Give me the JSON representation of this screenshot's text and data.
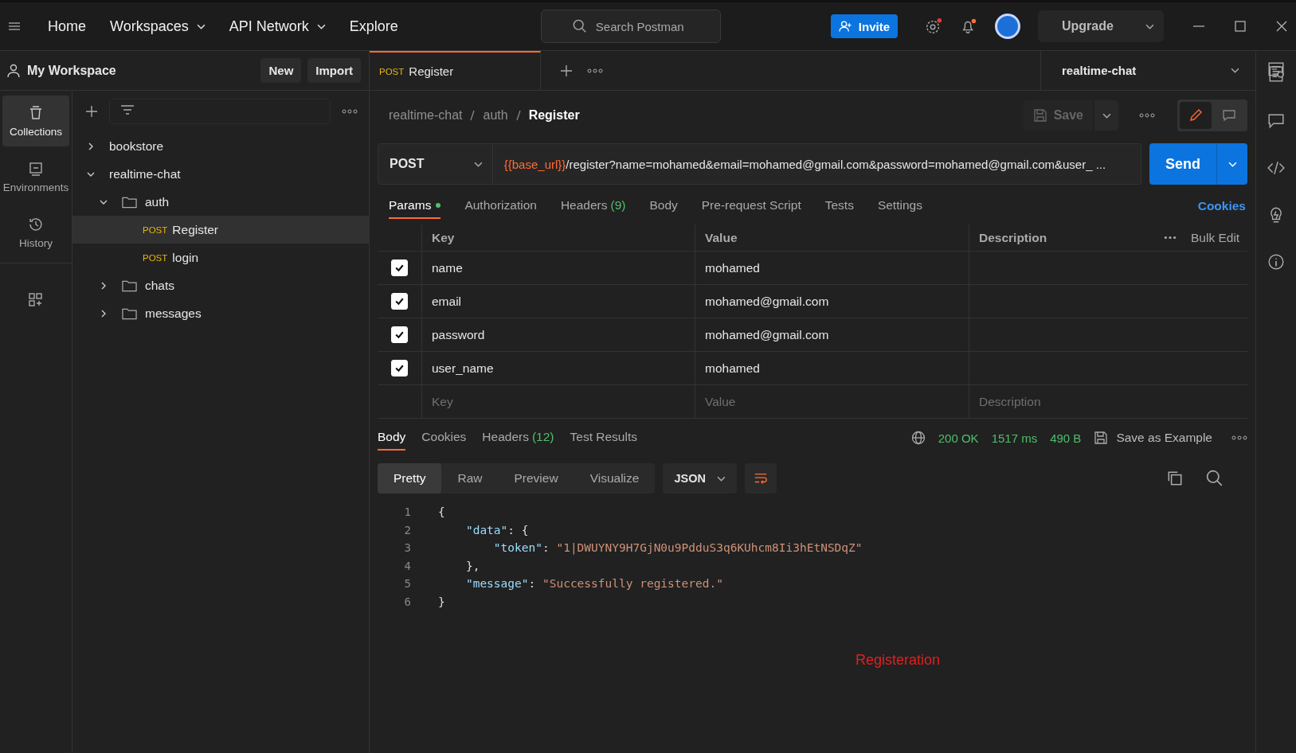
{
  "topbar": {
    "nav": [
      {
        "label": "Home",
        "dropdown": false
      },
      {
        "label": "Workspaces",
        "dropdown": true
      },
      {
        "label": "API Network",
        "dropdown": true
      },
      {
        "label": "Explore",
        "dropdown": false
      }
    ],
    "search": {
      "placeholder": "Search Postman"
    },
    "invite": "Invite",
    "upgrade": "Upgrade"
  },
  "workspace": {
    "name": "My Workspace",
    "buttons": [
      "New",
      "Import"
    ]
  },
  "rail": [
    {
      "label": "Collections",
      "selected": true
    },
    {
      "label": "Environments",
      "selected": false
    },
    {
      "label": "History",
      "selected": false
    },
    {
      "selected": false
    }
  ],
  "tree": [
    {
      "name": "bookstore",
      "kind": "collection",
      "expanded": false,
      "selected": false
    },
    {
      "name": "realtime-chat",
      "kind": "collection",
      "expanded": true,
      "selected": false,
      "children": [
        {
          "name": "auth",
          "kind": "folder",
          "expanded": true,
          "selected": false,
          "children": [
            {
              "name": "Register",
              "kind": "request",
              "method": "POST",
              "selected": true
            },
            {
              "name": "login",
              "kind": "request",
              "method": "POST",
              "selected": false
            }
          ]
        },
        {
          "name": "chats",
          "kind": "folder",
          "expanded": false,
          "selected": false
        },
        {
          "name": "messages",
          "kind": "folder",
          "expanded": false,
          "selected": false
        }
      ]
    }
  ],
  "tabs": [
    {
      "method": "POST",
      "label": "Register",
      "selected": true
    }
  ],
  "environment": "realtime-chat",
  "breadcrumb": [
    "realtime-chat",
    "auth",
    "Register"
  ],
  "save": "Save",
  "request": {
    "method": "POST",
    "url_variable": "{{base_url}}",
    "url_rest": "/register?name=mohamed&email=mohamed@gmail.com&password=mohamed@gmail.com&user_ ...",
    "send": "Send"
  },
  "request_tabs": [
    {
      "label": "Params",
      "dot": true,
      "selected": true
    },
    {
      "label": "Authorization",
      "selected": false
    },
    {
      "label": "Headers",
      "count": "(9)",
      "selected": false
    },
    {
      "label": "Body",
      "selected": false
    },
    {
      "label": "Pre-request Script",
      "selected": false
    },
    {
      "label": "Tests",
      "selected": false
    },
    {
      "label": "Settings",
      "selected": false
    }
  ],
  "cookies": "Cookies",
  "params": {
    "columns": [
      "Key",
      "Value",
      "Description"
    ],
    "bulk_edit": "Bulk Edit",
    "rows": [
      {
        "key": "name",
        "value": "mohamed",
        "checked": true
      },
      {
        "key": "email",
        "value": "mohamed@gmail.com",
        "checked": true
      },
      {
        "key": "password",
        "value": "mohamed@gmail.com",
        "checked": true
      },
      {
        "key": "user_name",
        "value": "mohamed",
        "checked": true
      }
    ],
    "new_row": {
      "key_placeholder": "Key",
      "value_placeholder": "Value",
      "description_placeholder": "Description"
    }
  },
  "response_tabs": [
    {
      "label": "Body",
      "selected": true
    },
    {
      "label": "Cookies",
      "selected": false
    },
    {
      "label": "Headers",
      "count": "(12)",
      "selected": false
    },
    {
      "label": "Test Results",
      "selected": false
    }
  ],
  "response_meta": {
    "status": "200 OK",
    "time": "1517 ms",
    "size": "490 B",
    "save_example": "Save as Example"
  },
  "view_modes": [
    {
      "label": "Pretty",
      "selected": true
    },
    {
      "label": "Raw",
      "selected": false
    },
    {
      "label": "Preview",
      "selected": false
    },
    {
      "label": "Visualize",
      "selected": false
    }
  ],
  "format": "JSON",
  "code": [
    {
      "n": "1",
      "tokens": [
        {
          "kind": "bracket",
          "text": "{"
        }
      ]
    },
    {
      "n": "2",
      "tokens": [
        {
          "kind": "key",
          "text": "    \"data\""
        },
        {
          "kind": "punct",
          "text": ": {"
        }
      ]
    },
    {
      "n": "3",
      "tokens": [
        {
          "kind": "key",
          "text": "        \"token\""
        },
        {
          "kind": "punct",
          "text": ": "
        },
        {
          "kind": "string",
          "text": "\"1|DWUYNY9H7GjN0u9PdduS3q6KUhcm8Ii3hEtNSDqZ\""
        }
      ]
    },
    {
      "n": "4",
      "tokens": [
        {
          "kind": "punct",
          "text": "    },"
        }
      ]
    },
    {
      "n": "5",
      "tokens": [
        {
          "kind": "key",
          "text": "    \"message\""
        },
        {
          "kind": "punct",
          "text": ": "
        },
        {
          "kind": "string",
          "text": "\"Successfully registered.\""
        }
      ]
    },
    {
      "n": "6",
      "tokens": [
        {
          "kind": "bracket",
          "text": "}"
        }
      ]
    }
  ],
  "annotation": "Registeration"
}
